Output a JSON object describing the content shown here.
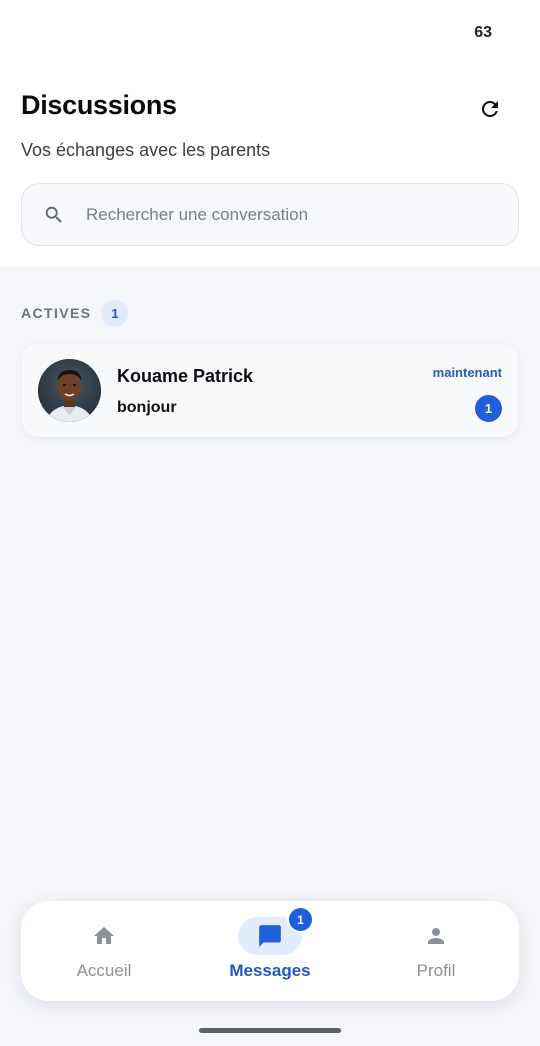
{
  "status_bar": {
    "battery": "63"
  },
  "header": {
    "title": "Discussions",
    "subtitle": "Vos échanges avec les parents",
    "refresh_icon": "refresh-icon"
  },
  "search": {
    "placeholder": "Rechercher une conversation",
    "value": "",
    "icon": "search-icon"
  },
  "section": {
    "label": "ACTIVES",
    "count": "1"
  },
  "conversations": [
    {
      "name": "Kouame Patrick",
      "preview": "bonjour",
      "time": "maintenant",
      "unread": "1",
      "avatar": "avatar-photo"
    }
  ],
  "bottom_nav": {
    "items": [
      {
        "label": "Accueil",
        "icon": "home-icon",
        "active": false
      },
      {
        "label": "Messages",
        "icon": "chat-bubble-icon",
        "active": true,
        "badge": "1"
      },
      {
        "label": "Profil",
        "icon": "person-icon",
        "active": false
      }
    ]
  },
  "colors": {
    "accent": "#1f5fd9",
    "accent_text": "#2158c2",
    "background": "#f4f6fa",
    "active_pill": "#e3ecfd"
  }
}
